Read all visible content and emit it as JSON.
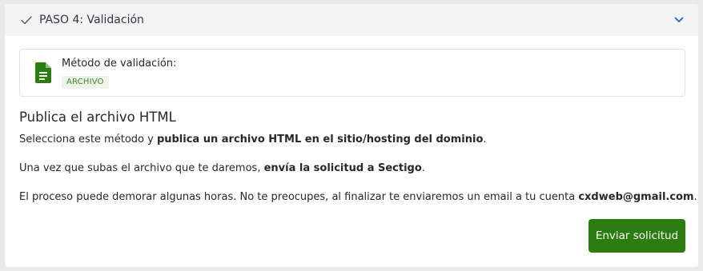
{
  "step": {
    "title": "PASO 4: Validación",
    "icons": {
      "status": "check-icon",
      "toggle": "chevron-down-icon"
    }
  },
  "method": {
    "icon": "file-document-icon",
    "label": "Método de validación:",
    "badge": "ARCHIVO"
  },
  "content": {
    "title": "Publica el archivo HTML",
    "p1_part1": "Selecciona este método y ",
    "p1_bold": "publica un archivo HTML en el sitio/hosting del dominio",
    "p1_part2": ".",
    "p2_part1": "Una vez que subas el archivo que te daremos, ",
    "p2_bold": "envía la solicitud a Sectigo",
    "p2_part2": ".",
    "p3_part1": "El proceso puede demorar algunas horas. No te preocupes, al finalizar te enviaremos un email a tu cuenta ",
    "p3_bold": "cxdweb@gmail.com",
    "p3_part2": "."
  },
  "actions": {
    "submit_label": "Enviar solicitud"
  },
  "colors": {
    "accent_green": "#2a7d0e",
    "badge_text": "#3c8a1e",
    "badge_bg": "#eef4ea",
    "chevron_blue": "#1a5fb4"
  }
}
